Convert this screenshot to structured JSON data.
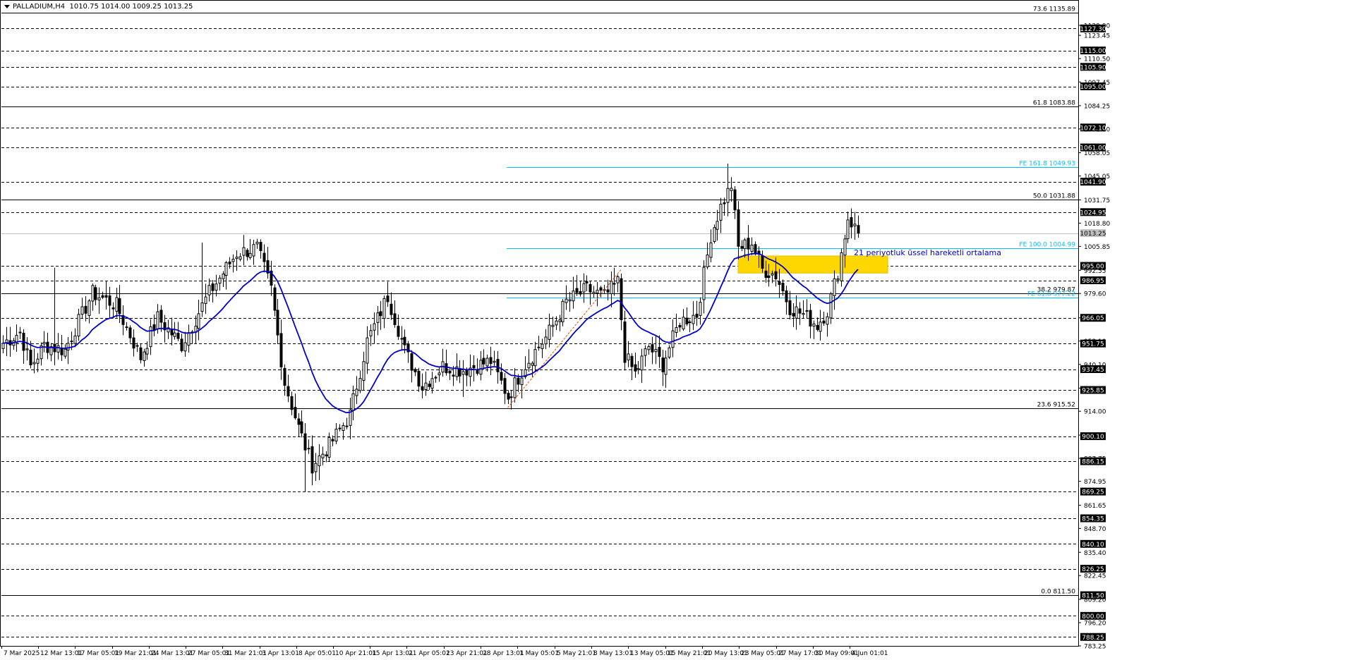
{
  "header": {
    "symbol": "PALLADIUM,H4",
    "ohlc": "1010.75 1014.00 1009.25 1013.25"
  },
  "colors": {
    "background": "#ffffff",
    "foreground": "#000000",
    "candle_up": "#ffffff",
    "candle_down": "#000000",
    "ema": "#0000cd",
    "fibo_expansion": "#00bfff",
    "trend_line": "#ff4500",
    "zone": "#ffd700"
  },
  "icons": {
    "menu": "triangle-down-icon"
  },
  "chart_data": {
    "type": "candlestick",
    "title": "PALLADIUM,H4",
    "ylim": [
      783.25,
      1136.85
    ],
    "current_price": 1013.25,
    "x_tick_labels": [
      "7 Mar 2025",
      "12 Mar 13:01",
      "17 Mar 05:01",
      "19 Mar 21:01",
      "24 Mar 13:01",
      "27 Mar 05:01",
      "31 Mar 21:01",
      "3 Apr 13:01",
      "8 Apr 05:01",
      "10 Apr 21:01",
      "15 Apr 13:01",
      "21 Apr 05:01",
      "23 Apr 21:01",
      "28 Apr 13:01",
      "1 May 05:01",
      "5 May 21:01",
      "8 May 13:01",
      "13 May 05:01",
      "15 May 21:01",
      "20 May 13:01",
      "23 May 05:01",
      "27 May 17:01",
      "30 May 09:01",
      "4 Jun 01:01"
    ],
    "y_tick_labels": [
      1129.0,
      1123.45,
      1110.5,
      1097.45,
      1084.25,
      1071.3,
      1058.05,
      1045.05,
      1031.75,
      1018.8,
      1005.85,
      992.55,
      979.6,
      966.05,
      953.1,
      940.1,
      926.9,
      914.0,
      900.7,
      887.75,
      874.95,
      861.65,
      848.7,
      835.4,
      822.45,
      809.2,
      796.2,
      783.25
    ],
    "horizontal_levels": [
      1127.3,
      1115.0,
      1105.9,
      1095.0,
      1072.1,
      1061.0,
      1041.9,
      1024.95,
      1013.25,
      995.0,
      986.95,
      966.05,
      951.75,
      937.45,
      925.85,
      900.1,
      886.15,
      869.25,
      854.35,
      840.1,
      826.25,
      811.5,
      800.0,
      788.25
    ],
    "fibonacci_retracement": [
      {
        "label": "73.6 1135.89",
        "price": 1135.89
      },
      {
        "label": "61.8 1083.88",
        "price": 1083.88
      },
      {
        "label": "50.0 1031.88",
        "price": 1031.88
      },
      {
        "label": "38.2 979.87",
        "price": 979.87
      },
      {
        "label": "23.6 915.52",
        "price": 915.52
      },
      {
        "label": "0.0 811.50",
        "price": 811.5
      }
    ],
    "fibonacci_expansion": [
      {
        "label": "FE 161.8 1049.93",
        "price": 1049.93
      },
      {
        "label": "FE 100.0 1004.99",
        "price": 1004.99
      },
      {
        "label": "FE 61.8 977.22",
        "price": 977.22
      }
    ],
    "zone": {
      "top": 1000.5,
      "bottom": 991.0
    },
    "annotation": "21 periyotluk üssel hareketli ortalama",
    "ema_period": 21,
    "anchors": [
      {
        "i": 0,
        "c": 952
      },
      {
        "i": 5,
        "c": 958
      },
      {
        "i": 8,
        "c": 939
      },
      {
        "i": 12,
        "c": 951
      },
      {
        "i": 18,
        "c": 948
      },
      {
        "i": 26,
        "c": 980
      },
      {
        "i": 33,
        "c": 973
      },
      {
        "i": 40,
        "c": 944
      },
      {
        "i": 45,
        "c": 966
      },
      {
        "i": 52,
        "c": 951
      },
      {
        "i": 60,
        "c": 980
      },
      {
        "i": 68,
        "c": 1002
      },
      {
        "i": 74,
        "c": 1005
      },
      {
        "i": 78,
        "c": 982
      },
      {
        "i": 82,
        "c": 930
      },
      {
        "i": 86,
        "c": 905
      },
      {
        "i": 90,
        "c": 884
      },
      {
        "i": 95,
        "c": 895
      },
      {
        "i": 101,
        "c": 912
      },
      {
        "i": 106,
        "c": 953
      },
      {
        "i": 112,
        "c": 978
      },
      {
        "i": 117,
        "c": 948
      },
      {
        "i": 122,
        "c": 928
      },
      {
        "i": 128,
        "c": 939
      },
      {
        "i": 134,
        "c": 937
      },
      {
        "i": 142,
        "c": 942
      },
      {
        "i": 147,
        "c": 922
      },
      {
        "i": 152,
        "c": 940
      },
      {
        "i": 158,
        "c": 955
      },
      {
        "i": 164,
        "c": 975
      },
      {
        "i": 170,
        "c": 982
      },
      {
        "i": 175,
        "c": 978
      },
      {
        "i": 179,
        "c": 986
      },
      {
        "i": 181,
        "c": 945
      },
      {
        "i": 184,
        "c": 935
      },
      {
        "i": 188,
        "c": 950
      },
      {
        "i": 192,
        "c": 940
      },
      {
        "i": 197,
        "c": 964
      },
      {
        "i": 202,
        "c": 968
      },
      {
        "i": 206,
        "c": 1012
      },
      {
        "i": 209,
        "c": 1028
      },
      {
        "i": 212,
        "c": 1040
      },
      {
        "i": 214,
        "c": 1005
      },
      {
        "i": 218,
        "c": 1008
      },
      {
        "i": 221,
        "c": 993
      },
      {
        "i": 225,
        "c": 990
      },
      {
        "i": 229,
        "c": 972
      },
      {
        "i": 233,
        "c": 968
      },
      {
        "i": 237,
        "c": 962
      },
      {
        "i": 240,
        "c": 970
      },
      {
        "i": 243,
        "c": 992
      },
      {
        "i": 246,
        "c": 1022
      },
      {
        "i": 249,
        "c": 1013.25
      }
    ]
  }
}
